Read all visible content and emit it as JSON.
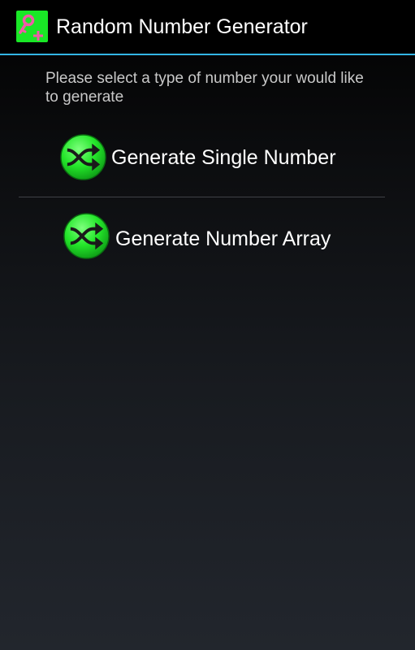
{
  "app": {
    "title": "Random Number Generator",
    "icon": "key-plus-icon"
  },
  "main": {
    "prompt": "Please select a type of number your would like to generate",
    "options": [
      {
        "label": "Generate Single Number",
        "icon": "shuffle-icon"
      },
      {
        "label": "Generate Number Array",
        "icon": "shuffle-icon"
      }
    ]
  },
  "colors": {
    "accent": "#33b5e5",
    "icon_green": "#19e826",
    "icon_pink": "#f05aa8"
  }
}
